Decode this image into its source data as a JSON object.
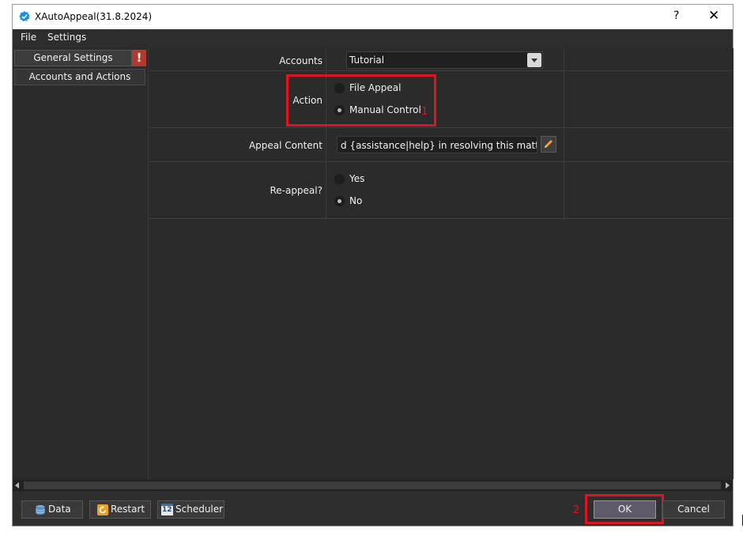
{
  "window": {
    "title": "XAutoAppeal(31.8.2024)",
    "help_label": "?",
    "close_label": "✕"
  },
  "menu": {
    "items": [
      {
        "label": "File"
      },
      {
        "label": "Settings"
      }
    ]
  },
  "sidebar": {
    "items": [
      {
        "label": "General Settings",
        "active": true
      },
      {
        "label": "Accounts and Actions",
        "active": false
      }
    ],
    "warning_badge": "!"
  },
  "settings": {
    "accounts": {
      "label": "Accounts",
      "value": "Tutorial"
    },
    "action": {
      "label": "Action",
      "options": [
        {
          "label": "File Appeal",
          "selected": false
        },
        {
          "label": "Manual Control",
          "selected": true
        }
      ]
    },
    "appeal_content": {
      "label": "Appeal Content",
      "value": "d {assistance|help} in resolving this matter"
    },
    "reappeal": {
      "label": "Re-appeal?",
      "options": [
        {
          "label": "Yes",
          "selected": false
        },
        {
          "label": "No",
          "selected": true
        }
      ]
    }
  },
  "bottom": {
    "data_label": "Data",
    "restart_label": "Restart",
    "scheduler_label": "Scheduler",
    "scheduler_icon_text": "12",
    "ok_label": "OK",
    "cancel_label": "Cancel"
  },
  "annotations": {
    "marker_1": "1",
    "marker_2": "2"
  },
  "colors": {
    "annotation": "#e0141e",
    "warning": "#b03a2e",
    "background": "#2b2b2b"
  }
}
